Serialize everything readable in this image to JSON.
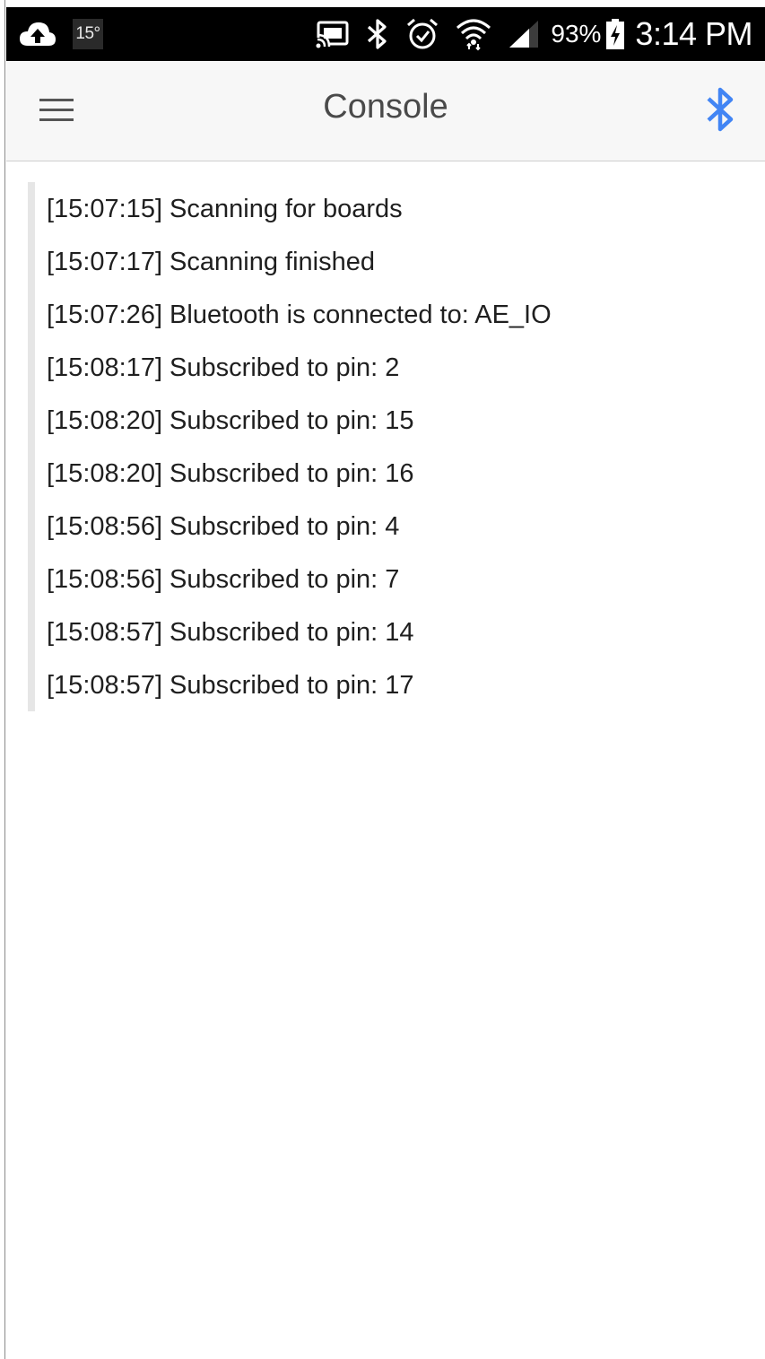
{
  "status_bar": {
    "temperature": "15°",
    "battery": "93%",
    "time": "3:14 PM",
    "icons": [
      "cloud-upload-icon",
      "cast-icon",
      "bluetooth-icon",
      "alarm-icon",
      "wifi-icon",
      "signal-icon",
      "battery-charging-icon"
    ]
  },
  "app_bar": {
    "title": "Console",
    "accent_color": "#4285f4"
  },
  "console": {
    "lines": [
      "[15:07:15] Scanning for boards",
      "[15:07:17] Scanning finished",
      "[15:07:26] Bluetooth is connected to: AE_IO",
      "[15:08:17] Subscribed to pin: 2",
      "[15:08:20] Subscribed to pin: 15",
      "[15:08:20] Subscribed to pin: 16",
      "[15:08:56] Subscribed to pin: 4",
      "[15:08:56] Subscribed to pin: 7",
      "[15:08:57] Subscribed to pin: 14",
      "[15:08:57] Subscribed to pin: 17"
    ]
  }
}
